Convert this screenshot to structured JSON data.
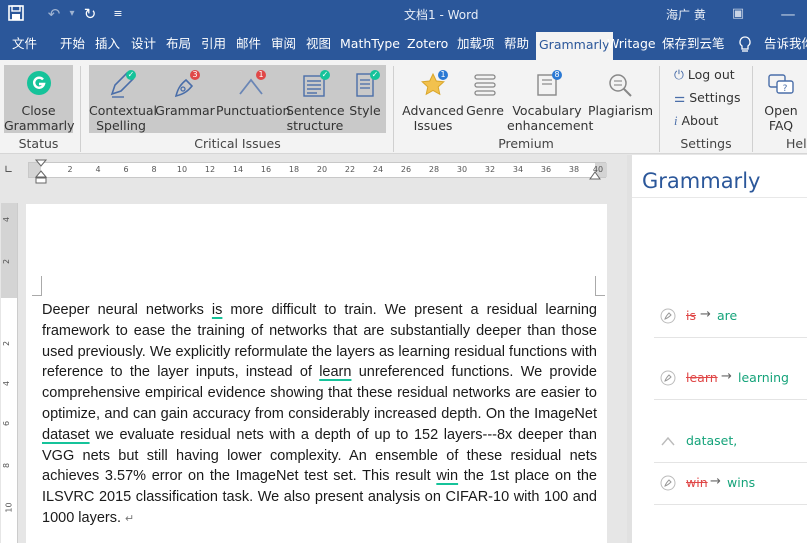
{
  "titlebar": {
    "doc_title": "文档1 - Word",
    "user": "海广 黄",
    "bg_color": "#2b579a"
  },
  "tabs": [
    "文件",
    "开始",
    "插入",
    "设计",
    "布局",
    "引用",
    "邮件",
    "审阅",
    "视图",
    "MathType",
    "Zotero",
    "加载项",
    "帮助",
    "Grammarly",
    "Writage",
    "保存到云笔",
    "告诉我你"
  ],
  "active_tab": "Grammarly",
  "ribbon": {
    "status": {
      "button": [
        "Close",
        "Grammarly"
      ],
      "label": "Status"
    },
    "critical": {
      "buttons": [
        {
          "label": [
            "Contextual",
            "Spelling"
          ],
          "icon": "pencil-icon",
          "badge": "check"
        },
        {
          "label": [
            "Grammar"
          ],
          "icon": "pen-nib-icon",
          "badge": "3"
        },
        {
          "label": [
            "Punctuation"
          ],
          "icon": "caret-icon",
          "badge": "1"
        },
        {
          "label": [
            "Sentence",
            "structure"
          ],
          "icon": "paragraph-icon",
          "badge": "check"
        },
        {
          "label": [
            "Style"
          ],
          "icon": "document-icon",
          "badge": "check"
        }
      ],
      "label": "Critical Issues"
    },
    "premium": {
      "buttons": [
        {
          "label": [
            "Advanced",
            "Issues"
          ],
          "icon": "star-icon",
          "badge": "1"
        },
        {
          "label": [
            "Genre"
          ],
          "icon": "lines-icon"
        },
        {
          "label": [
            "Vocabulary",
            "enhancement"
          ],
          "icon": "book-icon",
          "badge": "8"
        },
        {
          "label": [
            "Plagiarism"
          ],
          "icon": "magnifier-icon"
        }
      ],
      "label": "Premium"
    },
    "settings": {
      "items": [
        "Log out",
        "Settings",
        "About"
      ],
      "label": "Settings"
    },
    "help": {
      "button": [
        "Open",
        "FAQ"
      ],
      "label": "Hel"
    }
  },
  "ruler": {
    "numbers": [
      "2",
      "4",
      "6",
      "8",
      "10",
      "12",
      "14",
      "16",
      "18",
      "20",
      "22",
      "24",
      "26",
      "28",
      "30",
      "32",
      "34",
      "36",
      "38",
      "40"
    ],
    "vnumbers": [
      "4",
      "2",
      "2",
      "4",
      "6",
      "8",
      "10"
    ]
  },
  "document": {
    "segments": [
      {
        "t": "Deeper neural networks "
      },
      {
        "t": "is",
        "u": true
      },
      {
        "t": " more difficult to train. We present a residual learning framework to ease the training of networks that are substantially deeper than those used previously. We explicitly reformulate the layers as learning residual functions with reference to the layer inputs, instead of "
      },
      {
        "t": "learn",
        "u": true
      },
      {
        "t": " unreferenced functions. We provide comprehensive empirical evidence showing that these residual networks are easier to optimize, and can gain accuracy from considerably increased depth. On the ImageNet "
      },
      {
        "t": "dataset",
        "u": true
      },
      {
        "t": " we evaluate residual nets with a depth of up to 152 layers---8x deeper than VGG nets but still having lower complexity. An ensemble of these residual nets achieves 3.57% error on the ImageNet test set. This result "
      },
      {
        "t": "win",
        "u": true
      },
      {
        "t": " the 1st place on the ILSVRC 2015 classification task. We also present analysis on CIFAR-10 with 100 and 1000 layers. "
      },
      {
        "t": "↵",
        "mark": true
      }
    ]
  },
  "pane": {
    "title": "Grammarly",
    "suggestions": [
      {
        "old": "is",
        "arrow": "→",
        "new": "are",
        "icon": "pen-nib-icon"
      },
      {
        "old": "learn",
        "arrow": "→",
        "new": "learning",
        "icon": "pen-nib-icon"
      },
      {
        "old": "",
        "arrow": "",
        "new": "dataset,",
        "icon": "caret-icon"
      },
      {
        "old": "win",
        "arrow": "→",
        "new": "wins",
        "icon": "pen-nib-icon"
      }
    ]
  },
  "colors": {
    "accent": "#2b579a",
    "grammarly_green": "#15c39a",
    "error_red": "#e04848",
    "suggest_green": "#15a37a"
  }
}
